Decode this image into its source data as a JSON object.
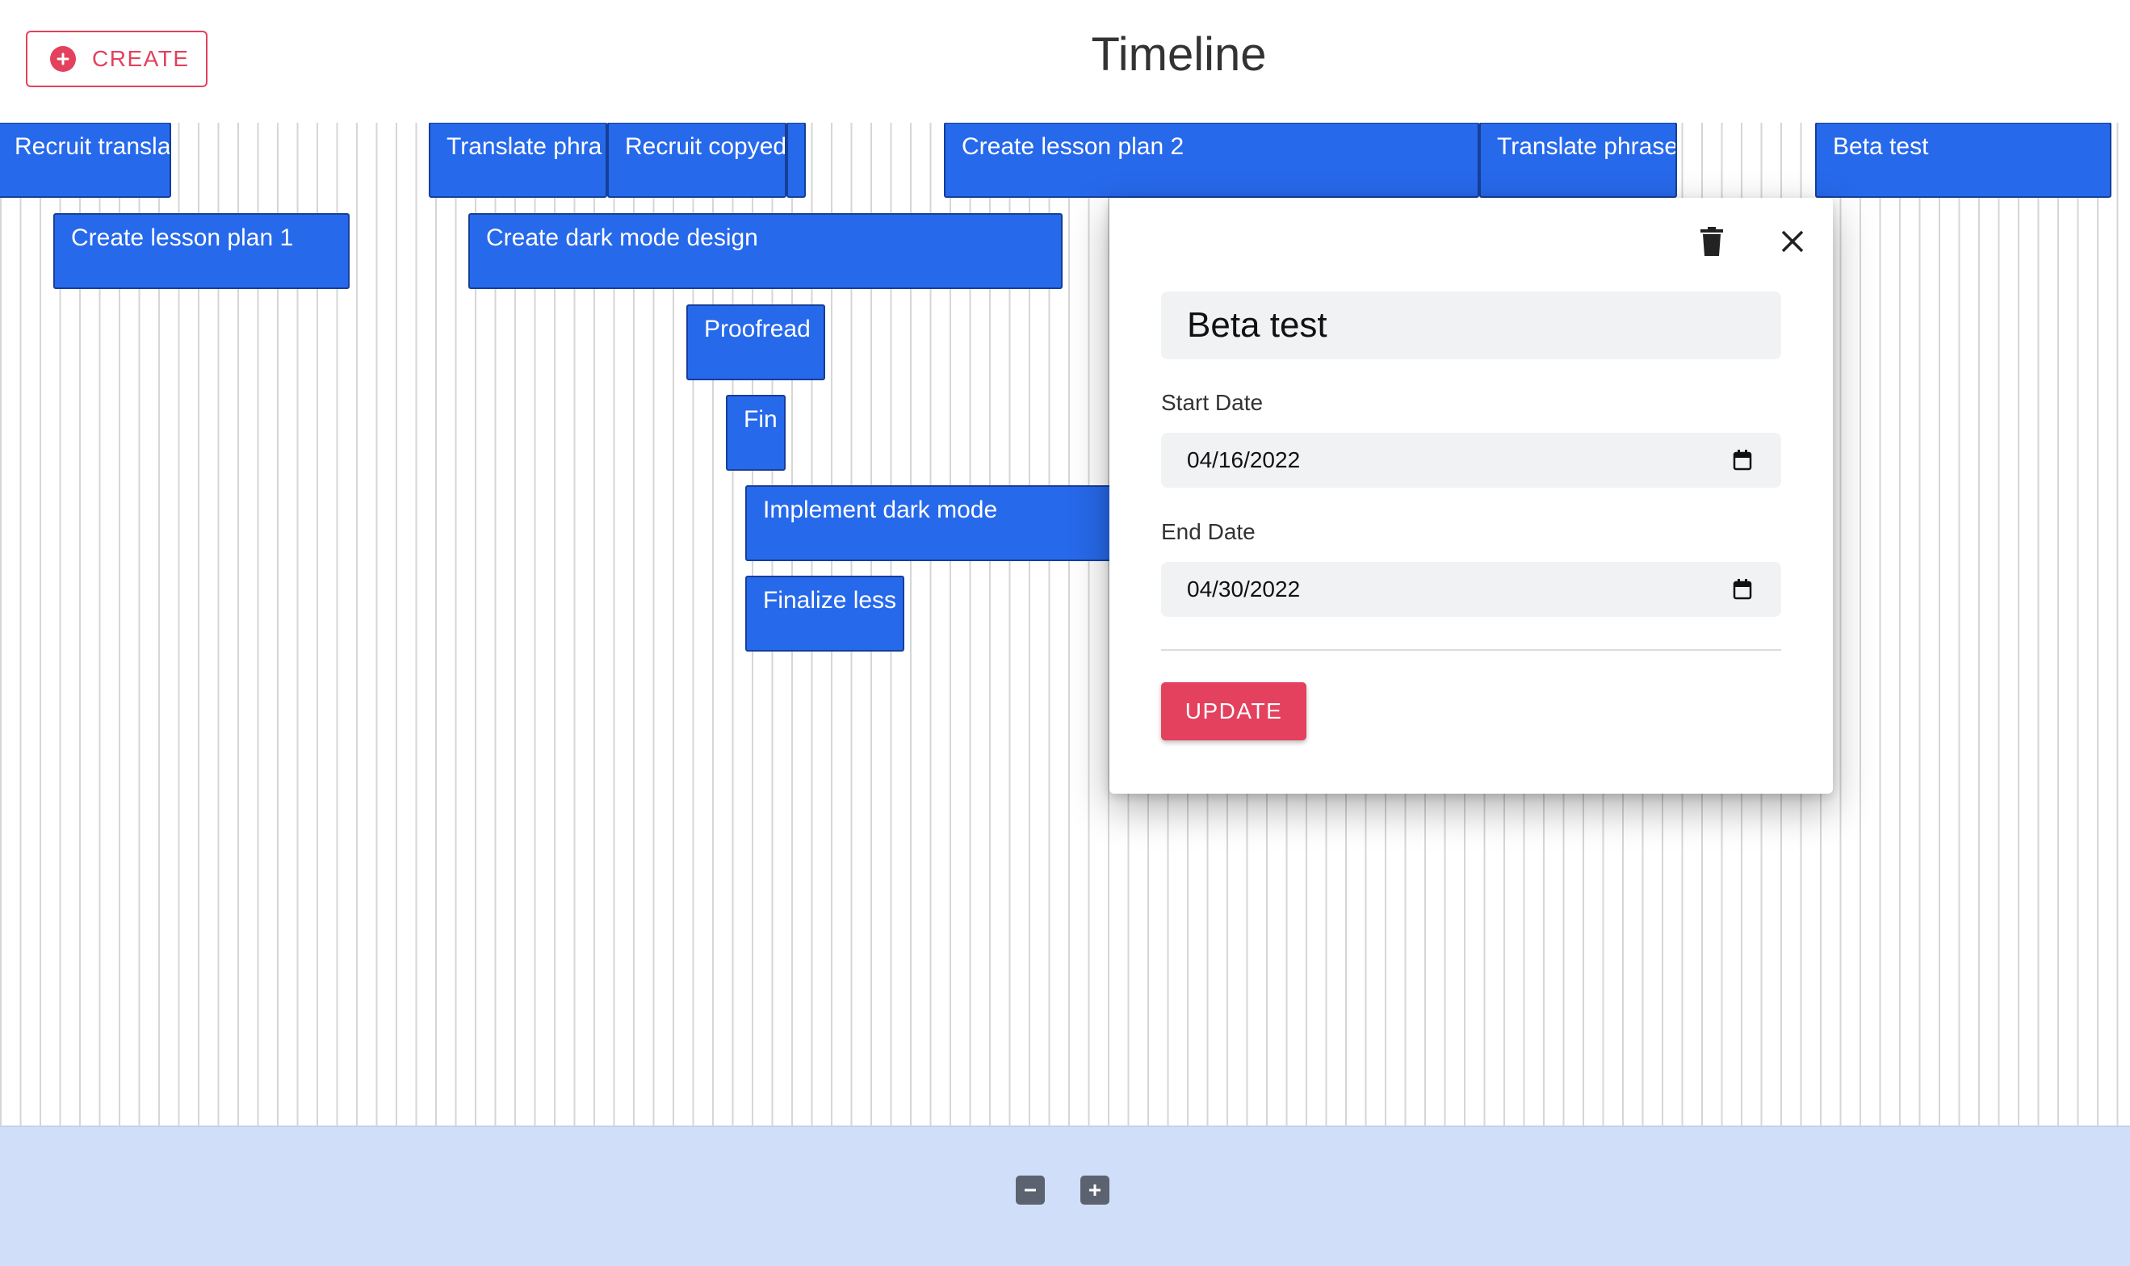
{
  "header": {
    "create_label": "CREATE",
    "title": "Timeline"
  },
  "timeline": {
    "tasks": [
      {
        "label": "Recruit transla"
      },
      {
        "label": "Translate phra"
      },
      {
        "label": "Recruit copyed"
      },
      {
        "label": ""
      },
      {
        "label": "Create lesson plan 2"
      },
      {
        "label": "Translate phrase"
      },
      {
        "label": "Beta test"
      },
      {
        "label": "Create lesson plan 1"
      },
      {
        "label": "Create dark mode design"
      },
      {
        "label": "Proofread"
      },
      {
        "label": "Fin"
      },
      {
        "label": "Implement dark mode"
      },
      {
        "label": "Finalize less"
      }
    ]
  },
  "editor": {
    "name_value": "Beta test",
    "start_label": "Start Date",
    "start_value": "04/16/2022",
    "end_label": "End Date",
    "end_value": "04/30/2022",
    "update_label": "UPDATE"
  },
  "footer": {
    "zoom_out_icon": "minus-icon",
    "zoom_in_icon": "plus-icon"
  },
  "colors": {
    "accent": "#e3415d",
    "bar": "#2769eb",
    "footer": "#d1defa"
  }
}
